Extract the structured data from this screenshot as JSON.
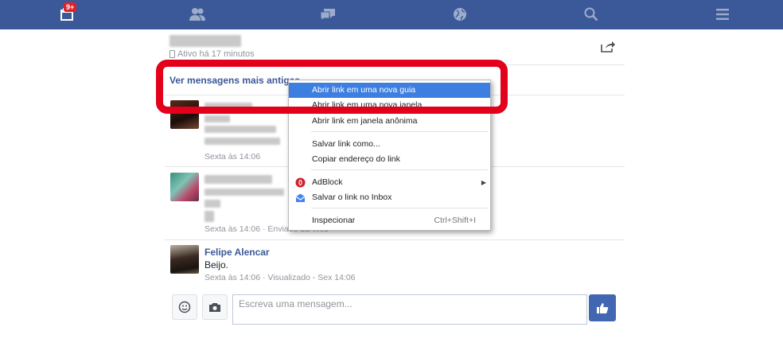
{
  "topbar": {
    "notifications_badge": "9+",
    "icons": [
      "calendar-icon",
      "friends-icon",
      "messages-icon",
      "globe-icon",
      "search-icon",
      "menu-icon"
    ]
  },
  "header": {
    "status": "Ativo há 17 minutos"
  },
  "older_link": "Ver mensagens mais antigas",
  "messages": [
    {
      "meta": "Sexta às 14:06"
    },
    {
      "meta": "Sexta às 14:06 · Enviado da Web"
    },
    {
      "name": "Felipe Alencar",
      "text": "Beijo.",
      "meta": "Sexta às 14:06 · Visualizado - Sex 14:06"
    }
  ],
  "composer": {
    "placeholder": "Escreva uma mensagem..."
  },
  "context_menu": {
    "items": [
      "Abrir link em uma nova guia",
      "Abrir link em uma nova janela",
      "Abrir link em janela anônima",
      "Salvar link como...",
      "Copiar endereço do link",
      "AdBlock",
      "Salvar o link no Inbox",
      "Inspecionar"
    ],
    "inspect_shortcut": "Ctrl+Shift+I"
  },
  "colors": {
    "topbar": "#3b5998",
    "highlight": "#e3001b",
    "menu_active": "#3d7fe0"
  }
}
